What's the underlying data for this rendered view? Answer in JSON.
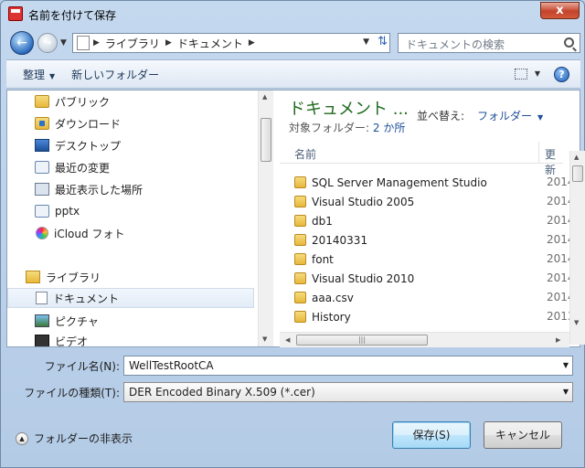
{
  "window": {
    "title": "名前を付けて保存",
    "close_label": "x"
  },
  "address": {
    "segments": [
      "ライブラリ",
      "ドキュメント"
    ]
  },
  "search": {
    "placeholder": "ドキュメントの検索"
  },
  "toolbar": {
    "organize": "整理",
    "new_folder": "新しいフォルダー"
  },
  "nav": {
    "items": [
      {
        "label": "パブリック",
        "icon": "folder-icon"
      },
      {
        "label": "ダウンロード",
        "icon": "downloads-folder-icon"
      },
      {
        "label": "デスクトップ",
        "icon": "desktop-icon"
      },
      {
        "label": "最近の変更",
        "icon": "recent-icon"
      },
      {
        "label": "最近表示した場所",
        "icon": "places-icon"
      },
      {
        "label": "pptx",
        "icon": "pptx-icon"
      },
      {
        "label": "iCloud フォト",
        "icon": "icloud-icon"
      },
      {
        "label": "ライブラリ",
        "icon": "library-icon"
      },
      {
        "label": "ドキュメント",
        "icon": "documents-icon"
      },
      {
        "label": "ピクチャ",
        "icon": "pictures-icon"
      },
      {
        "label": "ビデオ",
        "icon": "video-icon"
      }
    ]
  },
  "library": {
    "title": "ドキュメント ...",
    "target_label": "対象フォルダー:",
    "target_value": "2 か所",
    "arrange_label": "並べ替え:",
    "arrange_value": "フォルダー"
  },
  "columns": {
    "name": "名前",
    "date": "更新"
  },
  "files": [
    {
      "name": "SQL Server Management Studio",
      "date": "2014"
    },
    {
      "name": "Visual Studio 2005",
      "date": "2014"
    },
    {
      "name": "db1",
      "date": "2014"
    },
    {
      "name": "20140331",
      "date": "2014"
    },
    {
      "name": "font",
      "date": "2014"
    },
    {
      "name": "Visual Studio 2010",
      "date": "2014"
    },
    {
      "name": "aaa.csv",
      "date": "2014"
    },
    {
      "name": "History",
      "date": "2013"
    }
  ],
  "form": {
    "filename_label": "ファイル名(N):",
    "filename_value": "WellTestRootCA",
    "filetype_label": "ファイルの種類(T):",
    "filetype_value": "DER Encoded Binary X.509 (*.cer)"
  },
  "footer": {
    "hide_folders": "フォルダーの非表示",
    "save": "保存(S)",
    "cancel": "キャンセル"
  }
}
